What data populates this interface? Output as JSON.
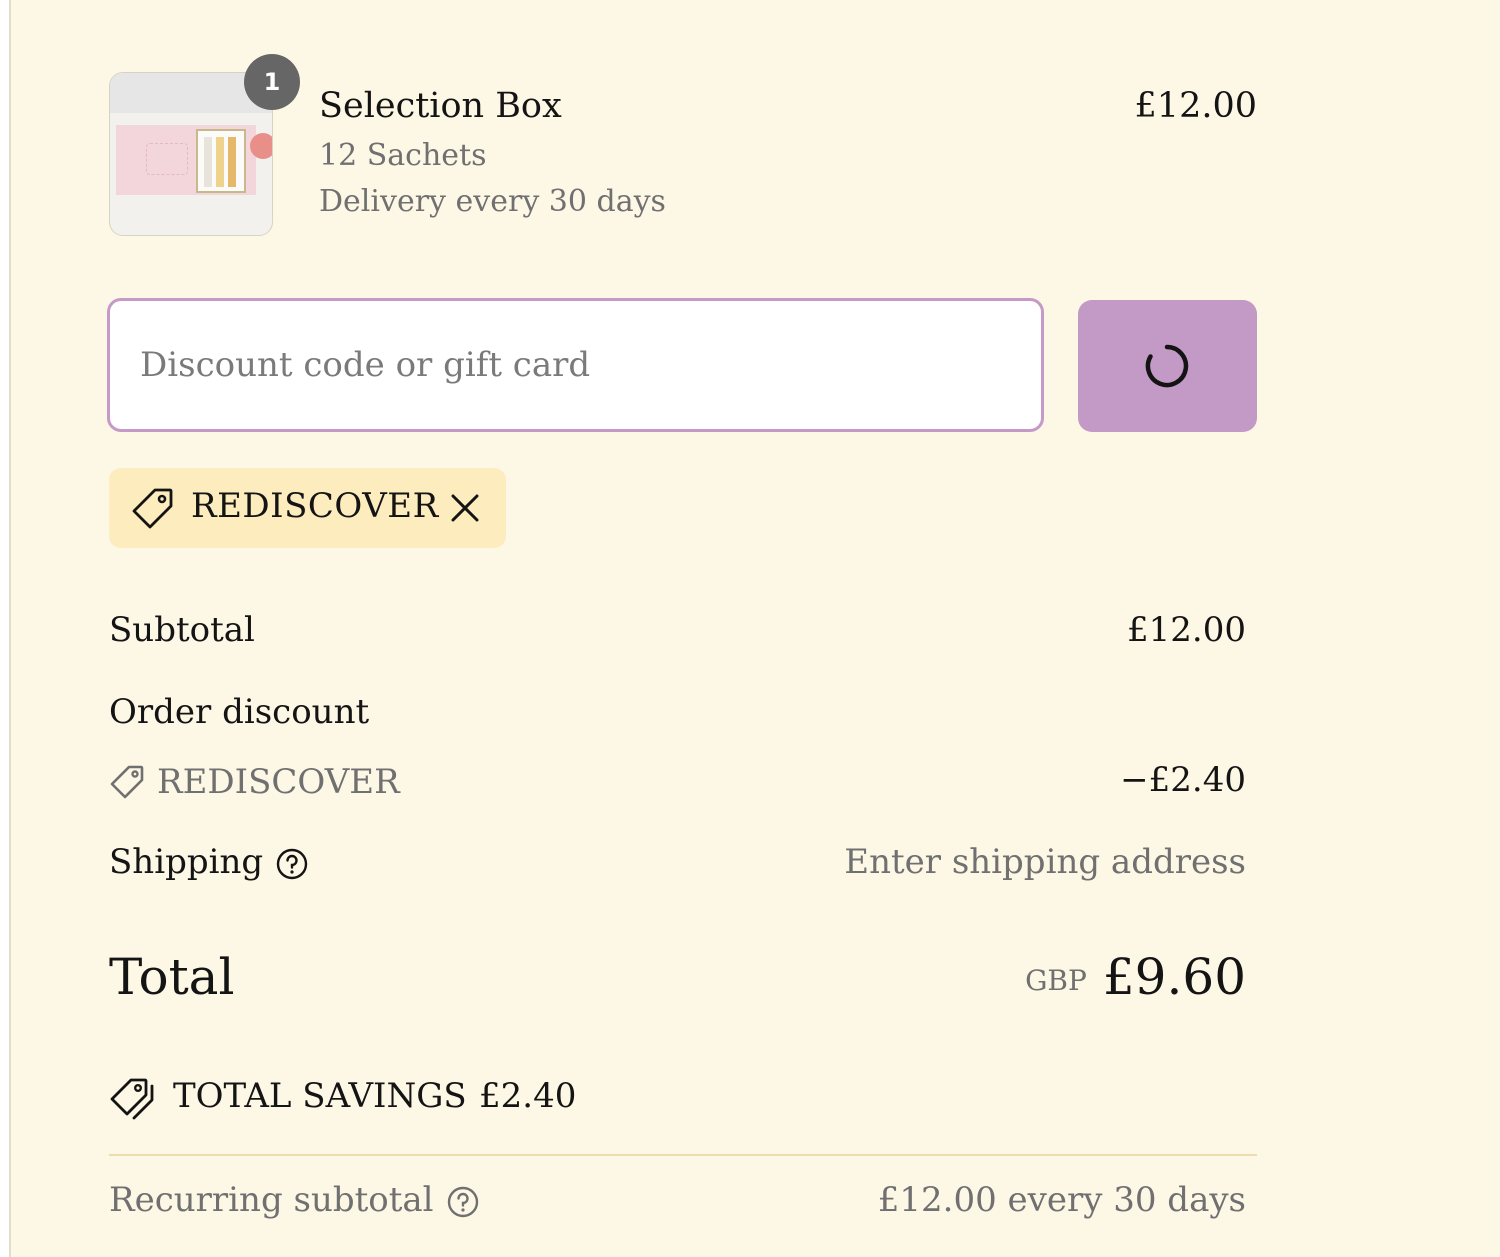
{
  "product": {
    "quantity": "1",
    "title": "Selection Box",
    "variant": "12 Sachets",
    "delivery": "Delivery every 30 days",
    "price": "£12.00",
    "image_icon": "product-thumbnail"
  },
  "discount": {
    "placeholder": "Discount code or gift card",
    "value": "",
    "apply_button_state": "loading",
    "applied_code": "REDISCOVER",
    "tag_icon": "tag-icon",
    "remove_icon": "close-icon"
  },
  "summary": {
    "subtotal_label": "Subtotal",
    "subtotal_value": "£12.00",
    "order_discount_label": "Order discount",
    "discount_code": "REDISCOVER",
    "discount_value": "−£2.40",
    "shipping_label": "Shipping",
    "shipping_value": "Enter shipping address",
    "total_label": "Total",
    "currency": "GBP",
    "total_value": "£9.60",
    "savings_label": "TOTAL SAVINGS",
    "savings_value": "£2.40",
    "recurring_label": "Recurring subtotal",
    "recurring_value": "£12.00 every 30 days"
  },
  "colors": {
    "panel_background": "#fdf7e6",
    "accent": "#c399c5",
    "input_border": "#c69ac8",
    "discount_tag_background": "#fdecbd",
    "muted_text": "#707070",
    "divider": "#ecdcae"
  }
}
